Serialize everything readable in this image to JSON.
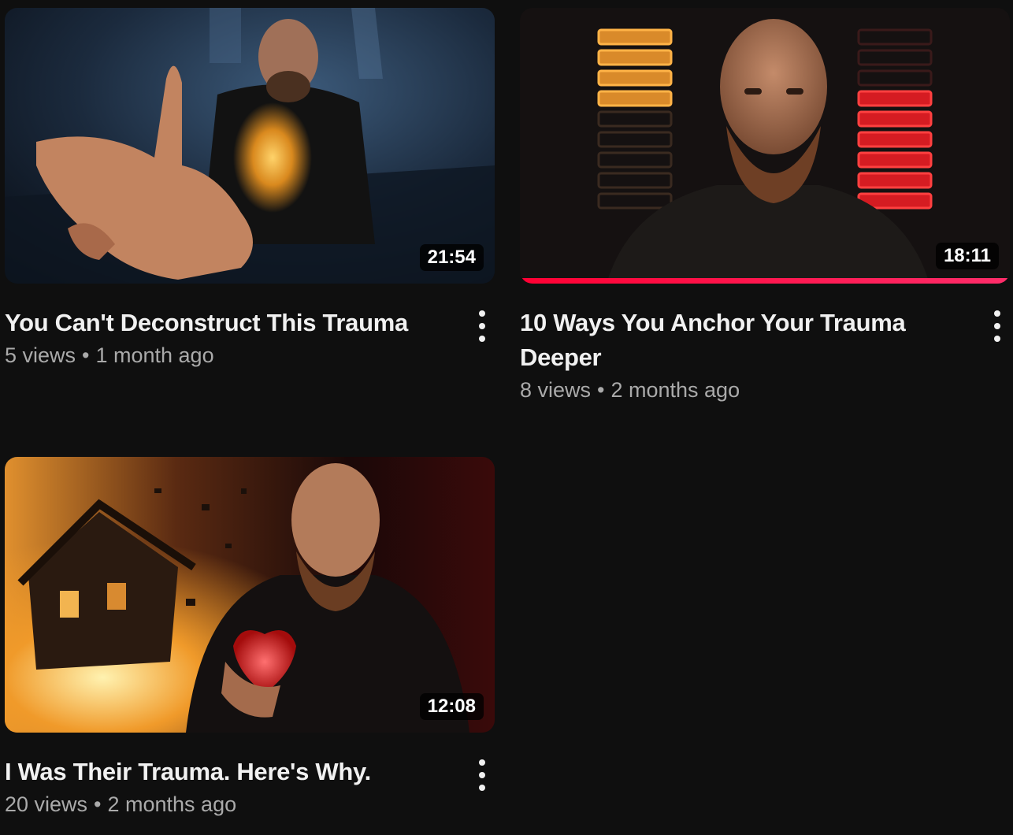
{
  "videos": [
    {
      "title": "You Can't Deconstruct This Trauma",
      "views": "5 views",
      "separator": "•",
      "age": "1 month ago",
      "duration": "21:54",
      "menu_icon": "more-vert-icon"
    },
    {
      "title": "10 Ways You Anchor Your Trauma Deeper",
      "views": "8 views",
      "separator": "•",
      "age": "2 months ago",
      "duration": "18:11",
      "watch_progress": 1.0,
      "progress_color": "#ff0033",
      "menu_icon": "more-vert-icon"
    },
    {
      "title": "I Was Their Trauma. Here's Why.",
      "views": "20 views",
      "separator": "•",
      "age": "2 months ago",
      "duration": "12:08",
      "menu_icon": "more-vert-icon"
    }
  ],
  "colors": {
    "background": "#0f0f0f",
    "title": "#f1f1f1",
    "subtext": "#aaaaaa",
    "accent": "#ff0033"
  }
}
